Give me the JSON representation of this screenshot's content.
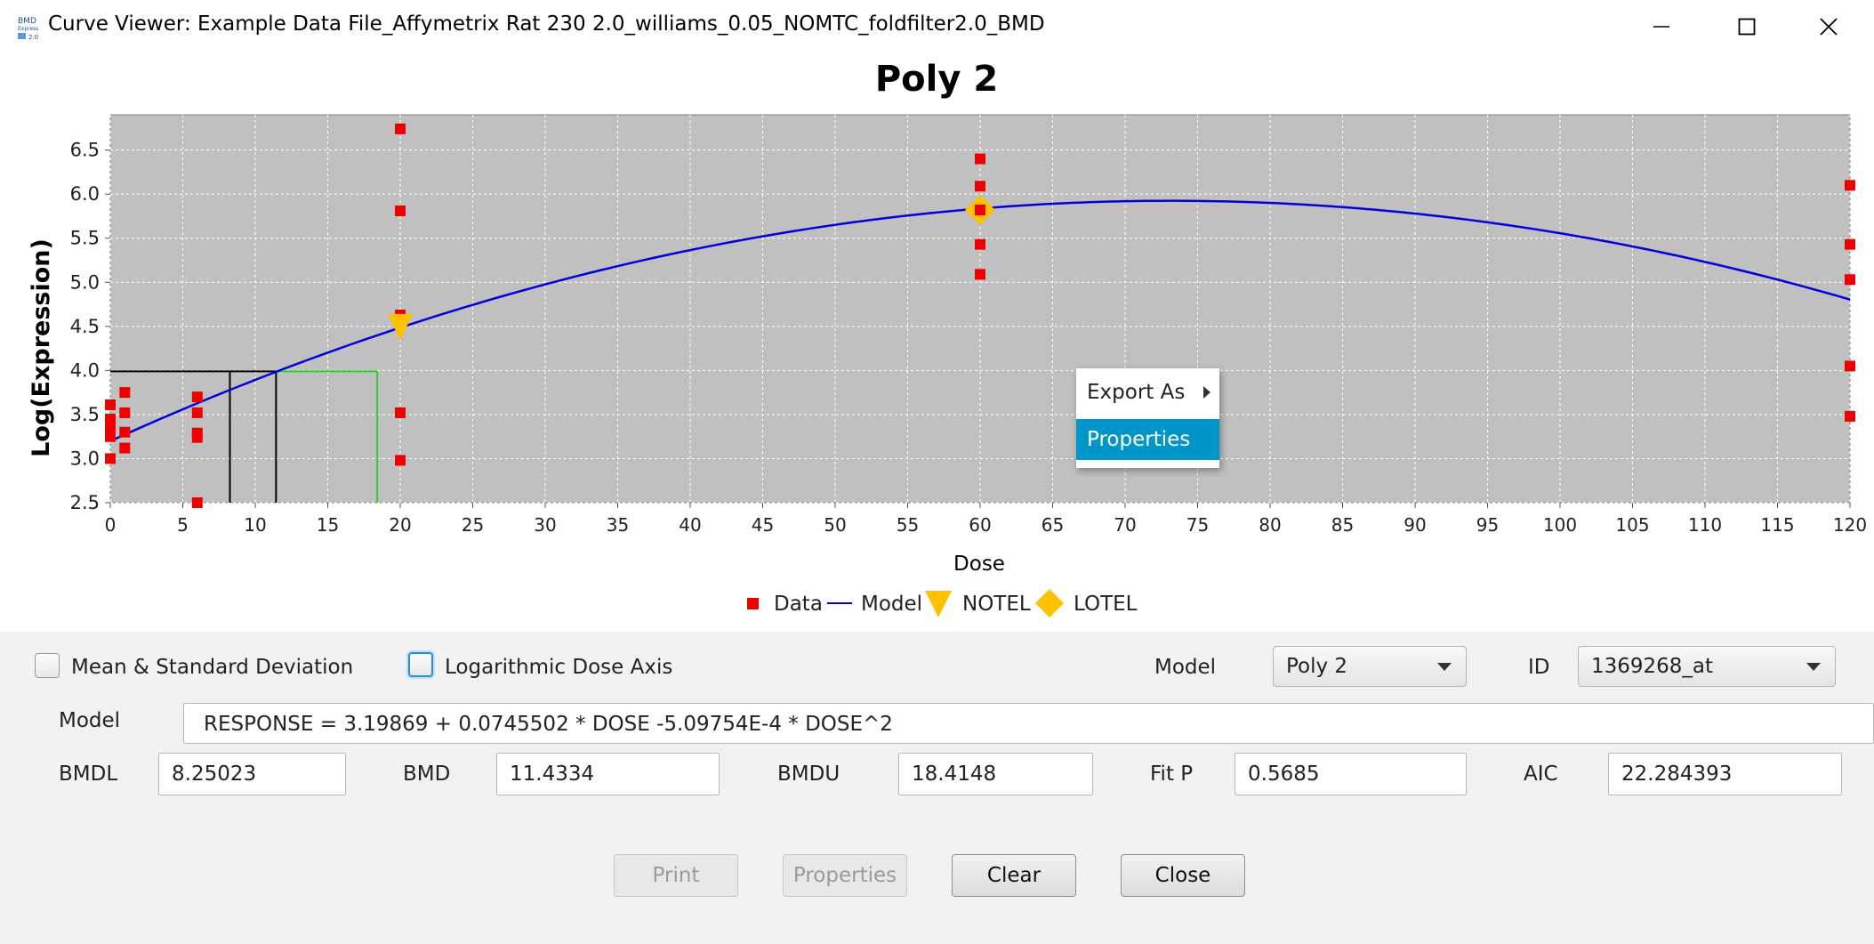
{
  "window": {
    "title": "Curve Viewer: Example Data File_Affymetrix Rat 230 2.0_williams_0.05_NOMTC_foldfilter2.0_BMD",
    "icon": "bmd-express-app-icon"
  },
  "chart_data": {
    "type": "scatter",
    "title": "Poly 2",
    "xlabel": "Dose",
    "ylabel": "Log(Expression)",
    "xlim": [
      0,
      120
    ],
    "ylim": [
      2.5,
      6.9
    ],
    "xticks": [
      0,
      5,
      10,
      15,
      20,
      25,
      30,
      35,
      40,
      45,
      50,
      55,
      60,
      65,
      70,
      75,
      80,
      85,
      90,
      95,
      100,
      105,
      110,
      115,
      120
    ],
    "yticks": [
      2.5,
      3.0,
      3.5,
      4.0,
      4.5,
      5.0,
      5.5,
      6.0,
      6.5
    ],
    "grid": true,
    "background": "#c0c0c0",
    "legend_position": "bottom-center",
    "legend": [
      {
        "name": "Data",
        "color": "#ee0000",
        "marker": "square"
      },
      {
        "name": "Model",
        "color": "#0000dd",
        "marker": "line"
      },
      {
        "name": "NOTEL",
        "color": "#ffc000",
        "marker": "triangle-down"
      },
      {
        "name": "LOTEL",
        "color": "#ffc000",
        "marker": "diamond"
      }
    ],
    "data_points": [
      {
        "x": 0,
        "y": 3.61
      },
      {
        "x": 0,
        "y": 3.45
      },
      {
        "x": 0,
        "y": 3.36
      },
      {
        "x": 0,
        "y": 3.25
      },
      {
        "x": 0,
        "y": 3.0
      },
      {
        "x": 1,
        "y": 3.75
      },
      {
        "x": 1,
        "y": 3.52
      },
      {
        "x": 1,
        "y": 3.3
      },
      {
        "x": 1,
        "y": 3.12
      },
      {
        "x": 6,
        "y": 3.7
      },
      {
        "x": 6,
        "y": 3.52
      },
      {
        "x": 6,
        "y": 3.29
      },
      {
        "x": 6,
        "y": 3.24
      },
      {
        "x": 6,
        "y": 2.5
      },
      {
        "x": 20,
        "y": 6.74
      },
      {
        "x": 20,
        "y": 5.81
      },
      {
        "x": 20,
        "y": 4.63
      },
      {
        "x": 20,
        "y": 3.52
      },
      {
        "x": 20,
        "y": 2.98
      },
      {
        "x": 60,
        "y": 6.4
      },
      {
        "x": 60,
        "y": 6.09
      },
      {
        "x": 60,
        "y": 5.82
      },
      {
        "x": 60,
        "y": 5.43
      },
      {
        "x": 60,
        "y": 5.09
      },
      {
        "x": 120,
        "y": 6.1
      },
      {
        "x": 120,
        "y": 5.43
      },
      {
        "x": 120,
        "y": 5.03
      },
      {
        "x": 120,
        "y": 4.05
      },
      {
        "x": 120,
        "y": 3.48
      }
    ],
    "model": {
      "b0": 3.19869,
      "b1": 0.0745502,
      "b2": -0.000509754,
      "x_start": 0,
      "x_end": 120,
      "color": "#0000dd"
    },
    "notel": {
      "x": 20,
      "y": 4.5
    },
    "lotel": {
      "x": 60,
      "y": 5.82
    },
    "bmd_response": 3.99,
    "bmdl": 8.25023,
    "bmd": 11.4334,
    "bmdu": 18.4148,
    "bmd_line_color": "#000000",
    "bmdu_line_color": "#33cc33"
  },
  "context_menu": {
    "items": [
      {
        "label": "Export As",
        "has_submenu": true
      },
      {
        "label": "Properties",
        "selected": true
      }
    ]
  },
  "controls": {
    "mean_sd_label": "Mean & Standard Deviation",
    "log_dose_label": "Logarithmic Dose Axis",
    "model_select_label": "Model",
    "model_select_value": "Poly 2",
    "id_label": "ID",
    "id_value": "1369268_at",
    "model_equation_label": "Model",
    "model_equation": "RESPONSE = 3.19869 + 0.0745502 * DOSE -5.09754E-4 * DOSE^2",
    "bmdl_label": "BMDL",
    "bmdl_value": "8.25023",
    "bmd_label": "BMD",
    "bmd_value": "11.4334",
    "bmdu_label": "BMDU",
    "bmdu_value": "18.4148",
    "fitp_label": "Fit P",
    "fitp_value": "0.5685",
    "aic_label": "AIC",
    "aic_value": "22.284393"
  },
  "buttons": {
    "print": "Print",
    "properties": "Properties",
    "clear": "Clear",
    "close": "Close"
  }
}
